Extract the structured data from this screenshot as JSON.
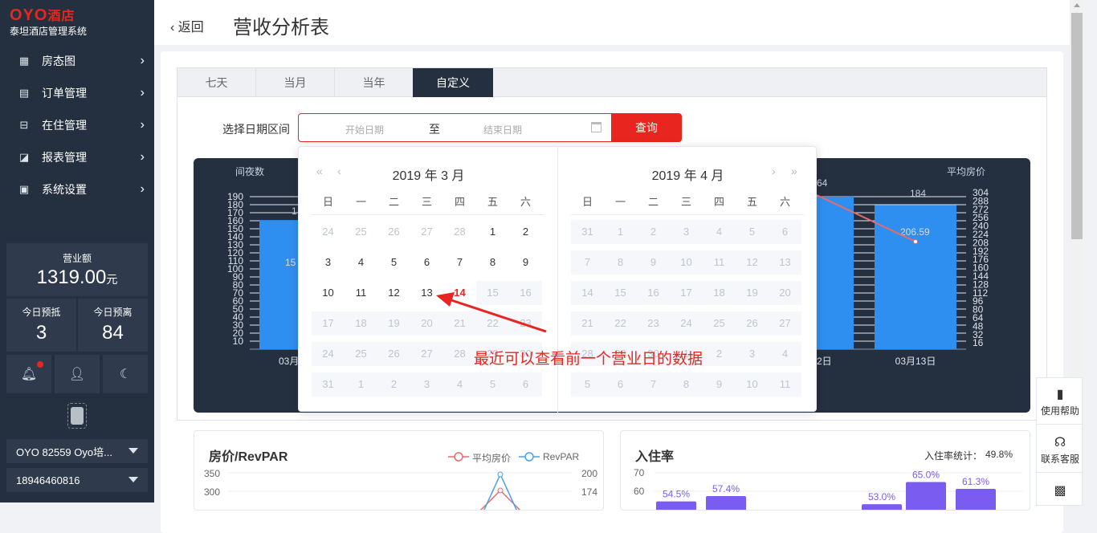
{
  "sidebar": {
    "logo_text": "OYO",
    "logo_suffix": "酒店",
    "system_name": "泰坦酒店管理系统",
    "menu": [
      {
        "label": "房态图",
        "icon": "grid-icon"
      },
      {
        "label": "订单管理",
        "icon": "document-icon"
      },
      {
        "label": "在住管理",
        "icon": "bed-icon"
      },
      {
        "label": "报表管理",
        "icon": "chart-icon"
      },
      {
        "label": "系统设置",
        "icon": "monitor-icon"
      }
    ],
    "revenue_label": "营业额",
    "revenue_value": "1319.00",
    "revenue_unit": "元",
    "arrivals_label": "今日预抵",
    "arrivals_value": "3",
    "departures_label": "今日预离",
    "departures_value": "84",
    "hotel_select": "OYO 82559 Oyo培...",
    "phone_select": "18946460816"
  },
  "header": {
    "back_label": "返回",
    "title": "营收分析表"
  },
  "tabs": [
    "七天",
    "当月",
    "当年",
    "自定义"
  ],
  "date_filter": {
    "label": "选择日期区间",
    "start_placeholder": "开始日期",
    "separator": "至",
    "end_placeholder": "结束日期",
    "query_button": "查询"
  },
  "picker": {
    "left_title": "2019 年 3 月",
    "right_title": "2019 年 4 月",
    "weekdays": [
      "日",
      "一",
      "二",
      "三",
      "四",
      "五",
      "六"
    ]
  },
  "annotation": "最近可以查看前一个营业日的数据",
  "chart_data": {
    "type": "bar",
    "left_axis_label": "间夜数",
    "right_axis_label": "平均房价",
    "left_ticks": [
      190,
      180,
      170,
      160,
      150,
      140,
      130,
      120,
      110,
      100,
      90,
      80,
      70,
      60,
      50,
      40,
      30,
      20,
      10
    ],
    "right_ticks": [
      304,
      288,
      272,
      256,
      240,
      224,
      208,
      192,
      176,
      160,
      144,
      128,
      112,
      96,
      80,
      64,
      48,
      32,
      16
    ],
    "categories": [
      "03月",
      "2日",
      "03月13日"
    ],
    "bar_values": [
      165,
      195,
      184
    ],
    "bar_labels": [
      "1",
      "",
      "184"
    ],
    "inner_labels": [
      "15",
      "",
      "206.59"
    ],
    "line_label_partial": "64",
    "line_values": [
      null,
      265,
      206.59
    ],
    "colors": {
      "bar": "#2f8ff0",
      "line": "#e86a6a",
      "background": "#243040"
    }
  },
  "bottom": {
    "price_title": "房价/RevPAR",
    "price_legend": [
      "平均房价",
      "RevPAR"
    ],
    "price_left_ticks": [
      "350",
      "300"
    ],
    "price_right_ticks": [
      "200",
      "174"
    ],
    "occ_title": "入住率",
    "occ_stat_label": "入住率统计：",
    "occ_stat_value": "49.8%",
    "occ_ticks": [
      "70",
      "60"
    ],
    "occ_bar_labels": [
      "54.5%",
      "57.4%",
      "53.0%",
      "65.0%",
      "61.3%"
    ],
    "occ_values": [
      54.5,
      57.4,
      53.0,
      65.0,
      61.3
    ]
  },
  "float_panel": {
    "help_label": "使用帮助",
    "service_label": "联系客服"
  }
}
